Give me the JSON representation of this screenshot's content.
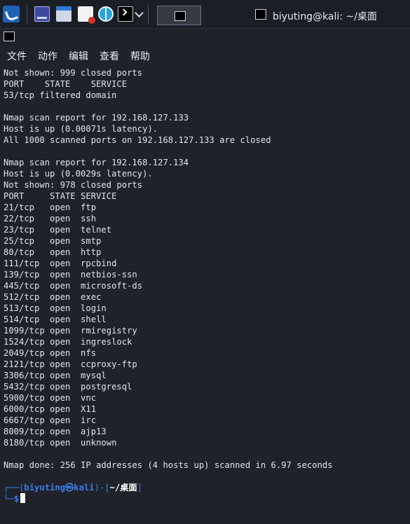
{
  "taskbar": {
    "window_title": "biyuting@kali: ~/桌面",
    "icons": [
      "kali-menu-icon",
      "workspace-icon",
      "file-manager-icon",
      "text-editor-icon",
      "web-browser-icon",
      "terminal-icon",
      "chevron-down-icon"
    ]
  },
  "window": {
    "menu": [
      "文件",
      "动作",
      "编辑",
      "查看",
      "帮助"
    ]
  },
  "terminal": {
    "lines": [
      "Not shown: 999 closed ports",
      "PORT    STATE    SERVICE",
      "53/tcp filtered domain",
      "",
      "Nmap scan report for 192.168.127.133",
      "Host is up (0.00071s latency).",
      "All 1000 scanned ports on 192.168.127.133 are closed",
      "",
      "Nmap scan report for 192.168.127.134",
      "Host is up (0.0029s latency).",
      "Not shown: 978 closed ports",
      "PORT     STATE SERVICE",
      "21/tcp   open  ftp",
      "22/tcp   open  ssh",
      "23/tcp   open  telnet",
      "25/tcp   open  smtp",
      "80/tcp   open  http",
      "111/tcp  open  rpcbind",
      "139/tcp  open  netbios-ssn",
      "445/tcp  open  microsoft-ds",
      "512/tcp  open  exec",
      "513/tcp  open  login",
      "514/tcp  open  shell",
      "1099/tcp open  rmiregistry",
      "1524/tcp open  ingreslock",
      "2049/tcp open  nfs",
      "2121/tcp open  ccproxy-ftp",
      "3306/tcp open  mysql",
      "5432/tcp open  postgresql",
      "5900/tcp open  vnc",
      "6000/tcp open  X11",
      "6667/tcp open  irc",
      "8009/tcp open  ajp13",
      "8180/tcp open  unknown",
      "",
      "Nmap done: 256 IP addresses (4 hosts up) scanned in 6.97 seconds"
    ],
    "prompt": {
      "corner_top": "┌──(",
      "user_host": "biyuting㉿kali",
      "mid": ")-[",
      "path": "~/桌面",
      "end": "]",
      "corner_bottom": "└─",
      "symbol": "$"
    }
  }
}
